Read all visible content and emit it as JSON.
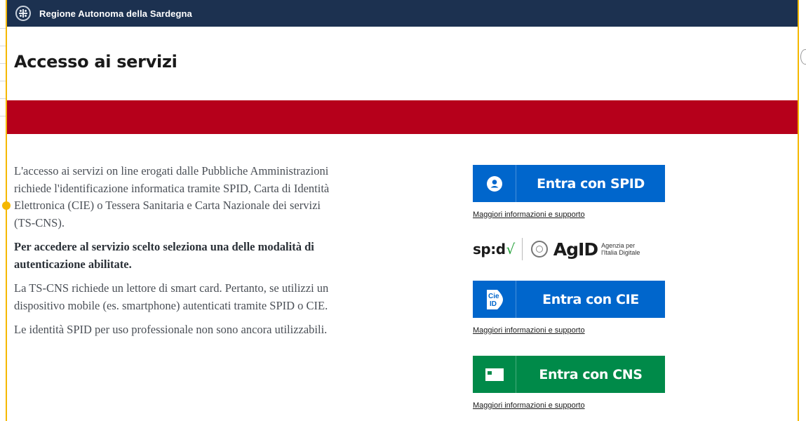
{
  "header": {
    "title": "Regione Autonoma della Sardegna",
    "emblem_icon": "sardinia-coat-of-arms-icon",
    "color": "#1c3150"
  },
  "page": {
    "title": "Accesso ai servizi",
    "band_color": "#b6001b"
  },
  "intro": {
    "paragraph_1": "L'accesso ai servizi on line erogati dalle Pubbliche Amministrazioni richiede l'identificazione informatica tramite SPID, Carta di Identità Elettronica (CIE) o Tessera Sanitaria e Carta Nazionale dei servizi (TS-CNS).",
    "lead": "Per accedere al servizio scelto seleziona una delle modalità di autenticazione abilitate.",
    "paragraph_2": "La TS-CNS richiede un lettore di smart card. Pertanto, se utilizzi un dispositivo mobile (es. smartphone) autenticati tramite SPID o CIE.",
    "paragraph_3": "Le identità SPID per uso professionale non sono ancora utilizzabili."
  },
  "auth": {
    "spid": {
      "label": "Entra con SPID",
      "icon": "user-icon",
      "help": "Maggiori informazioni e supporto",
      "color": "#0066cc"
    },
    "logos": {
      "spid_text": "sp:d",
      "spid_check": "√",
      "agid_text": "AgID",
      "agid_sub_1": "Agenzia per",
      "agid_sub_2": "l'Italia Digitale"
    },
    "cie": {
      "label": "Entra con CIE",
      "icon": "cie-id-icon",
      "icon_text_1": "Cie",
      "icon_text_2": "ID",
      "help": "Maggiori informazioni e supporto",
      "color": "#0066cc"
    },
    "cns": {
      "label": "Entra con CNS",
      "icon": "smart-card-icon",
      "help": "Maggiori informazioni e supporto",
      "color": "#008a49"
    }
  }
}
